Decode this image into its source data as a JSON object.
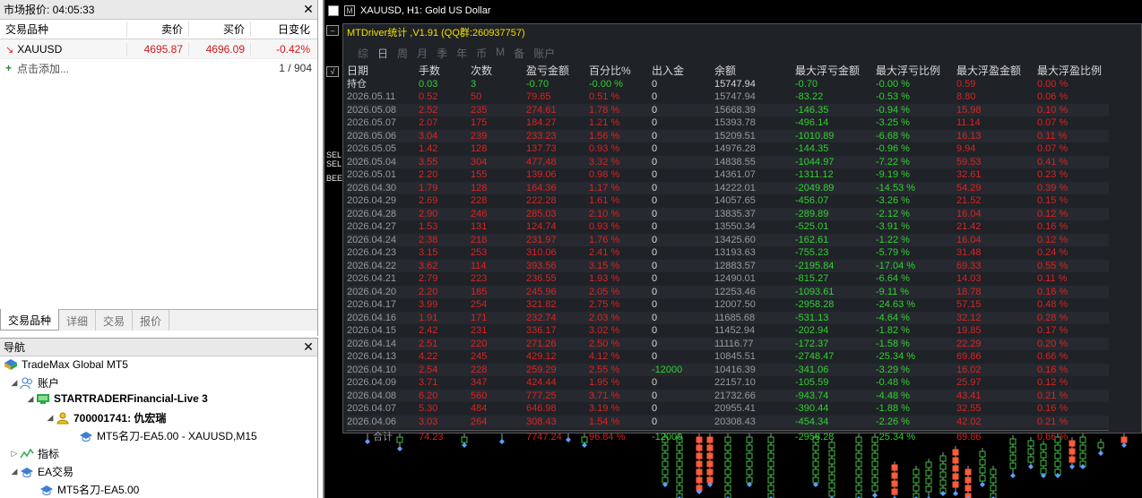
{
  "market_watch": {
    "title": "市场报价: 04:05:33",
    "headers": {
      "symbol": "交易品种",
      "bid": "卖价",
      "ask": "买价",
      "change": "日变化"
    },
    "rows": [
      {
        "symbol": "XAUUSD",
        "bid": "4695.87",
        "ask": "4696.09",
        "change": "-0.42%"
      }
    ],
    "add_label": "点击添加...",
    "count": "1 / 904",
    "tabs": [
      "交易品种",
      "详细",
      "交易",
      "报价"
    ]
  },
  "navigator": {
    "title": "导航",
    "broker": "TradeMax Global MT5",
    "accounts_label": "账户",
    "server": "STARTRADERFinancial-Live 3",
    "account": "700001741: 仇宏瑞",
    "ea_attached": "MT5名刀-EA5.00 - XAUUSD,M15",
    "indicators_label": "指标",
    "ea_label": "EA交易",
    "ea_item": "MT5名刀-EA5.00"
  },
  "chart": {
    "title": "XAUUSD, H1:  Gold US Dollar",
    "side_labels": [
      "SEL",
      "SEL",
      "BEE"
    ],
    "bg_color": "#000000"
  },
  "stats": {
    "title": "MTDriver统计 ,V1.91 (QQ群:260937757)",
    "tabs": [
      "综",
      "日",
      "周",
      "月",
      "季",
      "年",
      "币",
      "M",
      "备",
      "账户"
    ],
    "selected_tab": "日",
    "headers": [
      "日期",
      "手数",
      "次数",
      "盈亏金额",
      "百分比%",
      "出入金",
      "余额",
      "最大浮亏金额",
      "最大浮亏比例",
      "最大浮盈金额",
      "最大浮盈比例"
    ],
    "position_row": [
      "持仓",
      "0.03",
      "3",
      "-0.70",
      "-0.00 %",
      "0",
      "15747.94",
      "-0.70",
      "-0.00 %",
      "0.59",
      "0.00 %"
    ],
    "rows": [
      [
        "2026.05.11",
        "0.52",
        "50",
        "79.65",
        "0.51 %",
        "0",
        "15747.94",
        "-83.22",
        "-0.53 %",
        "8.80",
        "0.06 %"
      ],
      [
        "2026.05.08",
        "2.52",
        "235",
        "274.61",
        "1.78 %",
        "0",
        "15668.39",
        "-146.35",
        "-0.94 %",
        "15.98",
        "0.10 %"
      ],
      [
        "2026.05.07",
        "2.07",
        "175",
        "184.27",
        "1.21 %",
        "0",
        "15393.78",
        "-496.14",
        "-3.25 %",
        "11.14",
        "0.07 %"
      ],
      [
        "2026.05.06",
        "3.04",
        "239",
        "233.23",
        "1.56 %",
        "0",
        "15209.51",
        "-1010.89",
        "-6.68 %",
        "16.13",
        "0.11 %"
      ],
      [
        "2026.05.05",
        "1.42",
        "128",
        "137.73",
        "0.93 %",
        "0",
        "14976.28",
        "-144.35",
        "-0.96 %",
        "9.94",
        "0.07 %"
      ],
      [
        "2026.05.04",
        "3.55",
        "304",
        "477.48",
        "3.32 %",
        "0",
        "14838.55",
        "-1044.97",
        "-7.22 %",
        "59.53",
        "0.41 %"
      ],
      [
        "2026.05.01",
        "2.20",
        "155",
        "139.06",
        "0.98 %",
        "0",
        "14361.07",
        "-1311.12",
        "-9.19 %",
        "32.61",
        "0.23 %"
      ],
      [
        "2026.04.30",
        "1.79",
        "128",
        "164.36",
        "1.17 %",
        "0",
        "14222.01",
        "-2049.89",
        "-14.53 %",
        "54.29",
        "0.39 %"
      ],
      [
        "2026.04.29",
        "2.69",
        "228",
        "222.28",
        "1.61 %",
        "0",
        "14057.65",
        "-456.07",
        "-3.26 %",
        "21.52",
        "0.15 %"
      ],
      [
        "2026.04.28",
        "2.90",
        "246",
        "285.03",
        "2.10 %",
        "0",
        "13835.37",
        "-289.89",
        "-2.12 %",
        "16.04",
        "0.12 %"
      ],
      [
        "2026.04.27",
        "1.53",
        "131",
        "124.74",
        "0.93 %",
        "0",
        "13550.34",
        "-525.01",
        "-3.91 %",
        "21.42",
        "0.16 %"
      ],
      [
        "2026.04.24",
        "2.38",
        "218",
        "231.97",
        "1.76 %",
        "0",
        "13425.60",
        "-162.61",
        "-1.22 %",
        "16.04",
        "0.12 %"
      ],
      [
        "2026.04.23",
        "3.15",
        "253",
        "310.06",
        "2.41 %",
        "0",
        "13193.63",
        "-755.23",
        "-5.79 %",
        "31.48",
        "0.24 %"
      ],
      [
        "2026.04.22",
        "3.62",
        "114",
        "393.56",
        "3.15 %",
        "0",
        "12883.57",
        "-2195.84",
        "-17.04 %",
        "69.33",
        "0.55 %"
      ],
      [
        "2026.04.21",
        "2.79",
        "223",
        "236.55",
        "1.93 %",
        "0",
        "12490.01",
        "-815.27",
        "-6.64 %",
        "14.03",
        "0.11 %"
      ],
      [
        "2026.04.20",
        "2.20",
        "185",
        "245.96",
        "2.05 %",
        "0",
        "12253.46",
        "-1093.61",
        "-9.11 %",
        "18.78",
        "0.16 %"
      ],
      [
        "2026.04.17",
        "3.99",
        "254",
        "321.82",
        "2.75 %",
        "0",
        "12007.50",
        "-2958.28",
        "-24.63 %",
        "57.15",
        "0.48 %"
      ],
      [
        "2026.04.16",
        "1.91",
        "171",
        "232.74",
        "2.03 %",
        "0",
        "11685.68",
        "-531.13",
        "-4.64 %",
        "32.12",
        "0.28 %"
      ],
      [
        "2026.04.15",
        "2.42",
        "231",
        "336.17",
        "3.02 %",
        "0",
        "11452.94",
        "-202.94",
        "-1.82 %",
        "19.85",
        "0.17 %"
      ],
      [
        "2026.04.14",
        "2.51",
        "220",
        "271.26",
        "2.50 %",
        "0",
        "11116.77",
        "-172.37",
        "-1.58 %",
        "22.29",
        "0.20 %"
      ],
      [
        "2026.04.13",
        "4.22",
        "245",
        "429.12",
        "4.12 %",
        "0",
        "10845.51",
        "-2748.47",
        "-25.34 %",
        "69.86",
        "0.66 %"
      ],
      [
        "2026.04.10",
        "2.54",
        "228",
        "259.29",
        "2.55 %",
        "-12000",
        "10416.39",
        "-341.06",
        "-3.29 %",
        "16.02",
        "0.16 %"
      ],
      [
        "2026.04.09",
        "3.71",
        "347",
        "424.44",
        "1.95 %",
        "0",
        "22157.10",
        "-105.59",
        "-0.48 %",
        "25.97",
        "0.12 %"
      ],
      [
        "2026.04.08",
        "6.20",
        "560",
        "777.25",
        "3.71 %",
        "0",
        "21732.66",
        "-943.74",
        "-4.48 %",
        "43.41",
        "0.21 %"
      ],
      [
        "2026.04.07",
        "5.30",
        "484",
        "646.98",
        "3.19 %",
        "0",
        "20955.41",
        "-390.44",
        "-1.88 %",
        "32.55",
        "0.16 %"
      ],
      [
        "2026.04.06",
        "3.03",
        "264",
        "308.43",
        "1.54 %",
        "0",
        "20308.43",
        "-454.34",
        "-2.26 %",
        "42.02",
        "0.21 %"
      ]
    ],
    "total_row": [
      "合计",
      "74.23",
      "",
      "7747.24",
      "96.84 %",
      "-12000",
      "",
      "-2958.28",
      "-25.34 %",
      "69.86",
      "0.66 %"
    ]
  }
}
